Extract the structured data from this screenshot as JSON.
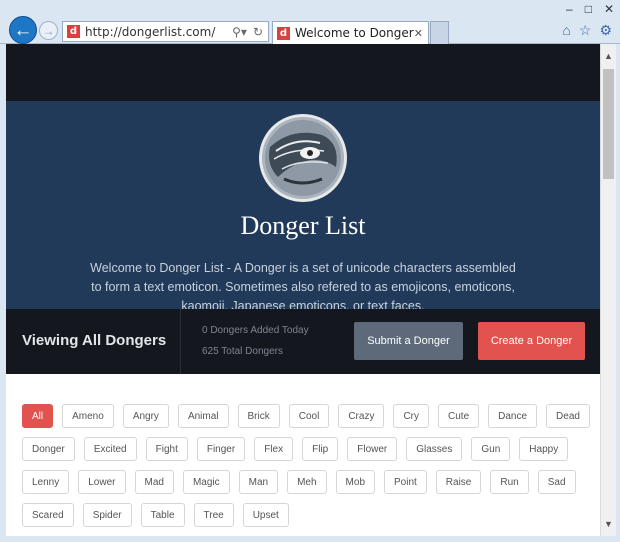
{
  "browser": {
    "url": "http://dongerlist.com/",
    "favicon_letter": "d",
    "tab_title": "Welcome to Donger List -...",
    "tab_close": "✕",
    "window_buttons": [
      "–",
      "□",
      "✕"
    ]
  },
  "hero": {
    "title": "Donger List",
    "description": "Welcome to Donger List - A Donger is a set of unicode characters assembled to form a text emoticon. Sometimes also refered to as emojicons, emoticons, kaomoji, Japanese emoticons, or text faces."
  },
  "stats": {
    "viewing_label": "Viewing All Dongers",
    "added_today": "0 Dongers Added Today",
    "total": "625 Total Dongers",
    "submit_label": "Submit a Donger",
    "create_label": "Create a Donger"
  },
  "categories": {
    "selected": "All",
    "rows": [
      [
        "All",
        "Ameno",
        "Angry",
        "Animal",
        "Brick",
        "Cool",
        "Crazy",
        "Cry",
        "Cute",
        "Dance",
        "Dead"
      ],
      [
        "Donger",
        "Excited",
        "Fight",
        "Finger",
        "Flex",
        "Flip",
        "Flower",
        "Glasses",
        "Gun",
        "Happy"
      ],
      [
        "Lenny",
        "Lower",
        "Mad",
        "Magic",
        "Man",
        "Meh",
        "Mob",
        "Point",
        "Raise",
        "Run",
        "Sad"
      ],
      [
        "Scared",
        "Spider",
        "Table",
        "Tree",
        "Upset"
      ]
    ]
  },
  "colors": {
    "hero_bg": "#223a59",
    "dark_bg": "#14171d",
    "accent_red": "#e2524f",
    "submit_gray": "#5e6a7a"
  },
  "icons": [
    "back-arrow-icon",
    "forward-arrow-icon",
    "search-icon",
    "refresh-icon",
    "home-icon",
    "star-icon",
    "gear-icon"
  ]
}
